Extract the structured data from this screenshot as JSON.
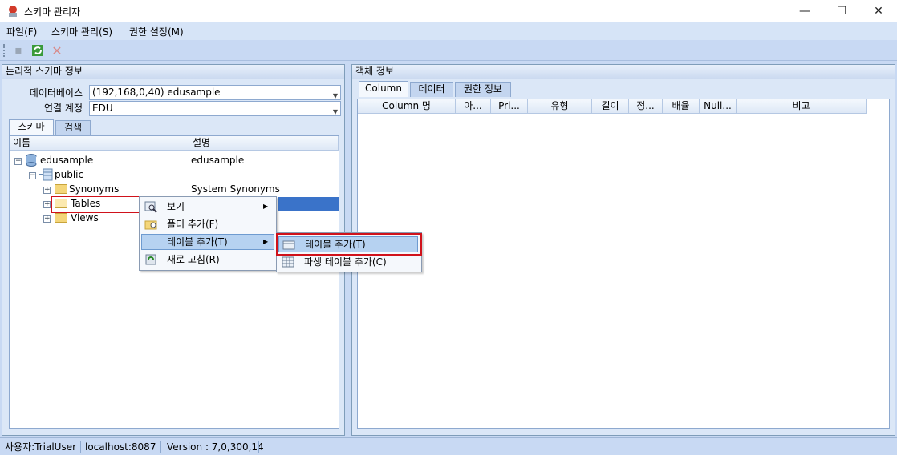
{
  "window": {
    "title": "스키마 관리자"
  },
  "menu": [
    "파일(F)",
    "스키마 관리(S)",
    "권한 설정(M)"
  ],
  "left_panel": {
    "header": "논리적 스키마 정보",
    "db_label": "데이터베이스",
    "db_value": "(192,168,0,40) edusample",
    "conn_label": "연결 계정",
    "conn_value": "EDU",
    "tabs": [
      "스키마",
      "검색"
    ],
    "columns": [
      "이름",
      "설명"
    ],
    "tree": {
      "root": "edusample",
      "root_desc": "edusample",
      "schema": "public",
      "synonyms": "Synonyms",
      "synonyms_desc": "System Synonyms",
      "tables": "Tables",
      "views": "Views"
    }
  },
  "context_menu": {
    "items": [
      "보기",
      "폴더 추가(F)",
      "테이블 추가(T)",
      "새로 고침(R)"
    ],
    "submenu": [
      "테이블 추가(T)",
      "파생 테이블 추가(C)"
    ]
  },
  "right_panel": {
    "header": "객체 정보",
    "tabs": [
      "Column",
      "데이터",
      "권한 정보"
    ],
    "columns": [
      "Column 명",
      "아...",
      "Pri...",
      "유형",
      "길이",
      "정...",
      "배율",
      "Null...",
      "비고"
    ]
  },
  "status": [
    "사용자:TrialUser",
    "localhost:8087",
    "Version : 7,0,300,14"
  ],
  "colors": {
    "highlight_border": "#d0121b",
    "selection": "#3a73c9"
  }
}
